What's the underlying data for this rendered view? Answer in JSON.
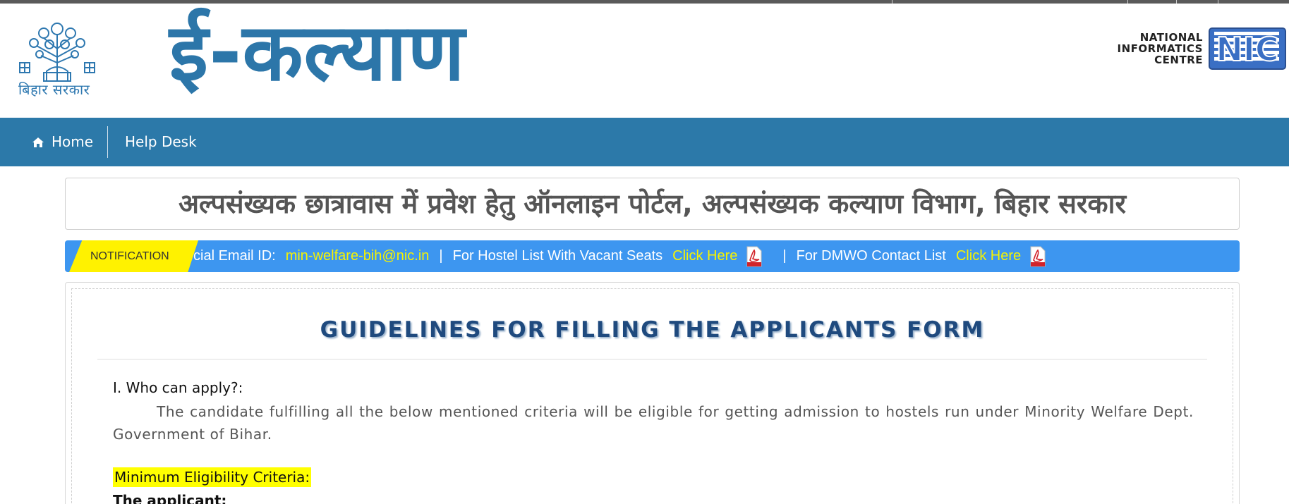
{
  "header": {
    "emblem_caption": "बिहार सरकार",
    "site_title": "ई-कल्याण",
    "nic_lines": [
      "NATIONAL",
      "INFORMATICS",
      "CENTRE"
    ],
    "nic_logo_text": "NIC"
  },
  "nav": {
    "home_icon": "home-icon",
    "home_label": "Home",
    "help_label": "Help Desk"
  },
  "portal_title": "अल्पसंख्यक छात्रावास में प्रवेश हेतु ऑनलाइन पोर्टल, अल्पसंख्यक कल्याण विभाग, बिहार सरकार",
  "notification": {
    "badge": "NOTIFICATION",
    "email_prefix": "cial Email ID:",
    "email": "min-welfare-bih@nic.in",
    "sep": "|",
    "hostel_text": "For Hostel List With Vacant Seats",
    "hostel_link": "Click Here",
    "dmwo_text": "For DMWO Contact List",
    "dmwo_link": "Click Here"
  },
  "guidelines": {
    "title": "GUIDELINES FOR FILLING THE APPLICANTS FORM",
    "q1_heading": "I. Who can apply?:",
    "q1_text": "The candidate fulfilling all the below mentioned criteria will be eligible for getting admission to hostels run under Minority Welfare Dept. Government of Bihar.",
    "criteria_heading": "Minimum Eligibility Criteria:",
    "applicant_label": "The applicant:"
  },
  "colors": {
    "brand_blue": "#2c79a9",
    "notice_blue": "#3d96f0",
    "highlight_yellow": "#ffff00",
    "link_yellow": "#f7f300"
  }
}
